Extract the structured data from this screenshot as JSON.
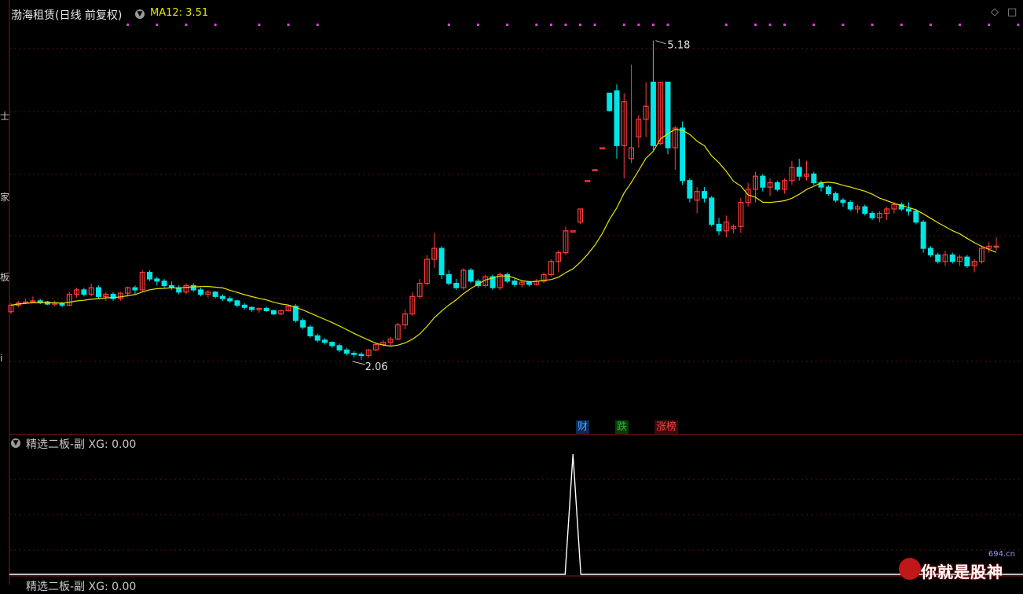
{
  "header": {
    "stock_name": "渤海租赁(日线 前复权)",
    "ma_label": "MA12: 3.51"
  },
  "indicator": {
    "label": "精选二板-副 XG: 0.00",
    "label_bottom": "精选二板-副 XG: 0.00"
  },
  "annotations": {
    "high_label": "5.18",
    "low_label": "2.06"
  },
  "event_tags": [
    {
      "text": "财",
      "color": "#4ea0ff"
    },
    {
      "text": "跌",
      "color": "#20c020"
    },
    {
      "text": "涨榜",
      "color": "#ff4040"
    }
  ],
  "side_labels": [
    "士",
    "家",
    "板",
    "i"
  ],
  "watermark": {
    "text": "你就是股神",
    "site": "694.cn"
  },
  "colors": {
    "up": "#ff3c3c",
    "down": "#00e5e5",
    "ma": "#e6e600",
    "grid": "#5a1010",
    "signal_dots": "#e040e0"
  },
  "chart_data": {
    "type": "candlestick",
    "title": "渤海租赁(日线 前复权)",
    "series_ma": "MA12",
    "price_range": [
      1.8,
      5.3
    ],
    "candles": [
      [
        2.7,
        2.78,
        2.68,
        2.76
      ],
      [
        2.76,
        2.8,
        2.74,
        2.78
      ],
      [
        2.78,
        2.82,
        2.77,
        2.79
      ],
      [
        2.79,
        2.84,
        2.78,
        2.8
      ],
      [
        2.8,
        2.82,
        2.77,
        2.79
      ],
      [
        2.79,
        2.8,
        2.76,
        2.77
      ],
      [
        2.77,
        2.8,
        2.75,
        2.78
      ],
      [
        2.78,
        2.79,
        2.74,
        2.76
      ],
      [
        2.76,
        2.88,
        2.75,
        2.86
      ],
      [
        2.86,
        2.92,
        2.83,
        2.9
      ],
      [
        2.9,
        2.92,
        2.84,
        2.86
      ],
      [
        2.86,
        2.96,
        2.84,
        2.92
      ],
      [
        2.92,
        2.94,
        2.82,
        2.84
      ],
      [
        2.84,
        2.88,
        2.8,
        2.86
      ],
      [
        2.86,
        2.88,
        2.8,
        2.82
      ],
      [
        2.82,
        2.88,
        2.8,
        2.87
      ],
      [
        2.87,
        2.93,
        2.84,
        2.92
      ],
      [
        2.92,
        2.94,
        2.86,
        2.9
      ],
      [
        2.9,
        3.08,
        2.88,
        3.06
      ],
      [
        3.06,
        3.08,
        2.98,
        3.0
      ],
      [
        3.0,
        3.02,
        2.94,
        2.98
      ],
      [
        2.98,
        3.0,
        2.92,
        2.94
      ],
      [
        2.94,
        2.98,
        2.9,
        2.92
      ],
      [
        2.92,
        2.94,
        2.86,
        2.88
      ],
      [
        2.88,
        2.96,
        2.86,
        2.94
      ],
      [
        2.94,
        2.96,
        2.88,
        2.9
      ],
      [
        2.9,
        2.92,
        2.84,
        2.86
      ],
      [
        2.86,
        2.9,
        2.83,
        2.88
      ],
      [
        2.88,
        2.89,
        2.82,
        2.84
      ],
      [
        2.84,
        2.86,
        2.8,
        2.82
      ],
      [
        2.82,
        2.84,
        2.78,
        2.8
      ],
      [
        2.8,
        2.81,
        2.74,
        2.76
      ],
      [
        2.76,
        2.78,
        2.72,
        2.74
      ],
      [
        2.74,
        2.75,
        2.7,
        2.72
      ],
      [
        2.72,
        2.74,
        2.69,
        2.73
      ],
      [
        2.73,
        2.75,
        2.7,
        2.71
      ],
      [
        2.71,
        2.72,
        2.67,
        2.68
      ],
      [
        2.68,
        2.72,
        2.67,
        2.71
      ],
      [
        2.71,
        2.76,
        2.7,
        2.75
      ],
      [
        2.75,
        2.77,
        2.6,
        2.62
      ],
      [
        2.62,
        2.64,
        2.54,
        2.56
      ],
      [
        2.56,
        2.58,
        2.46,
        2.48
      ],
      [
        2.48,
        2.5,
        2.42,
        2.44
      ],
      [
        2.44,
        2.46,
        2.4,
        2.42
      ],
      [
        2.42,
        2.43,
        2.37,
        2.39
      ],
      [
        2.39,
        2.41,
        2.33,
        2.35
      ],
      [
        2.35,
        2.37,
        2.3,
        2.32
      ],
      [
        2.32,
        2.34,
        2.28,
        2.31
      ],
      [
        2.31,
        2.33,
        2.26,
        2.3
      ],
      [
        2.3,
        2.36,
        2.28,
        2.35
      ],
      [
        2.35,
        2.42,
        2.34,
        2.4
      ],
      [
        2.4,
        2.44,
        2.38,
        2.42
      ],
      [
        2.42,
        2.47,
        2.39,
        2.45
      ],
      [
        2.45,
        2.6,
        2.44,
        2.58
      ],
      [
        2.58,
        2.72,
        2.54,
        2.68
      ],
      [
        2.68,
        2.88,
        2.66,
        2.84
      ],
      [
        2.84,
        3.0,
        2.82,
        2.96
      ],
      [
        2.96,
        3.22,
        2.94,
        3.18
      ],
      [
        3.18,
        3.42,
        3.1,
        3.28
      ],
      [
        3.28,
        3.3,
        3.0,
        3.04
      ],
      [
        3.04,
        3.08,
        2.94,
        2.96
      ],
      [
        2.96,
        3.0,
        2.9,
        2.92
      ],
      [
        2.92,
        3.1,
        2.9,
        3.08
      ],
      [
        3.08,
        3.1,
        2.96,
        2.98
      ],
      [
        2.98,
        3.0,
        2.92,
        2.94
      ],
      [
        2.94,
        3.04,
        2.92,
        3.02
      ],
      [
        3.02,
        3.04,
        2.9,
        2.92
      ],
      [
        2.92,
        3.06,
        2.9,
        3.04
      ],
      [
        3.04,
        3.06,
        2.96,
        2.98
      ],
      [
        2.98,
        3.0,
        2.93,
        2.95
      ],
      [
        2.95,
        2.98,
        2.92,
        2.97
      ],
      [
        2.97,
        2.98,
        2.93,
        2.95
      ],
      [
        2.95,
        3.0,
        2.94,
        2.98
      ],
      [
        2.98,
        3.06,
        2.96,
        3.04
      ],
      [
        3.04,
        3.18,
        3.02,
        3.16
      ],
      [
        3.16,
        3.26,
        3.06,
        3.24
      ],
      [
        3.24,
        3.48,
        3.22,
        3.44
      ],
      [
        3.44,
        3.44,
        3.44,
        3.44
      ],
      [
        3.52,
        3.64,
        3.5,
        3.64
      ],
      [
        3.9,
        3.9,
        3.9,
        3.9
      ],
      [
        4.0,
        4.0,
        4.0,
        4.0
      ],
      [
        4.2,
        4.2,
        4.2,
        4.2
      ],
      [
        4.7,
        4.7,
        4.7,
        4.54
      ],
      [
        4.72,
        4.78,
        4.1,
        4.22
      ],
      [
        4.22,
        4.7,
        3.92,
        4.62
      ],
      [
        4.1,
        4.96,
        4.06,
        4.2
      ],
      [
        4.3,
        4.5,
        4.2,
        4.46
      ],
      [
        4.46,
        4.8,
        4.3,
        4.58
      ],
      [
        4.8,
        5.18,
        4.18,
        4.22
      ],
      [
        4.24,
        4.8,
        4.22,
        4.8
      ],
      [
        4.8,
        4.8,
        4.14,
        4.2
      ],
      [
        4.2,
        4.4,
        4.0,
        4.38
      ],
      [
        4.38,
        4.44,
        3.86,
        3.9
      ],
      [
        3.9,
        3.92,
        3.7,
        3.74
      ],
      [
        3.72,
        3.84,
        3.6,
        3.8
      ],
      [
        3.8,
        3.84,
        3.7,
        3.74
      ],
      [
        3.74,
        3.76,
        3.48,
        3.5
      ],
      [
        3.5,
        3.56,
        3.4,
        3.44
      ],
      [
        3.44,
        3.58,
        3.38,
        3.52
      ],
      [
        3.46,
        3.5,
        3.42,
        3.48
      ],
      [
        3.48,
        3.74,
        3.42,
        3.7
      ],
      [
        3.7,
        3.88,
        3.66,
        3.82
      ],
      [
        3.82,
        3.98,
        3.7,
        3.94
      ],
      [
        3.94,
        3.96,
        3.8,
        3.84
      ],
      [
        3.84,
        3.92,
        3.76,
        3.88
      ],
      [
        3.88,
        3.9,
        3.8,
        3.82
      ],
      [
        3.82,
        3.92,
        3.78,
        3.9
      ],
      [
        3.9,
        4.08,
        3.86,
        4.02
      ],
      [
        4.02,
        4.1,
        3.9,
        3.94
      ],
      [
        3.94,
        4.08,
        3.9,
        3.96
      ],
      [
        3.96,
        3.98,
        3.86,
        3.88
      ],
      [
        3.88,
        3.9,
        3.8,
        3.84
      ],
      [
        3.84,
        3.86,
        3.76,
        3.78
      ],
      [
        3.78,
        3.8,
        3.7,
        3.72
      ],
      [
        3.72,
        3.74,
        3.66,
        3.7
      ],
      [
        3.7,
        3.72,
        3.62,
        3.64
      ],
      [
        3.64,
        3.68,
        3.6,
        3.66
      ],
      [
        3.66,
        3.68,
        3.58,
        3.6
      ],
      [
        3.6,
        3.62,
        3.54,
        3.56
      ],
      [
        3.56,
        3.62,
        3.52,
        3.6
      ],
      [
        3.6,
        3.66,
        3.54,
        3.64
      ],
      [
        3.64,
        3.7,
        3.6,
        3.68
      ],
      [
        3.68,
        3.7,
        3.62,
        3.64
      ],
      [
        3.64,
        3.7,
        3.58,
        3.62
      ],
      [
        3.62,
        3.64,
        3.5,
        3.52
      ],
      [
        3.52,
        3.54,
        3.24,
        3.28
      ],
      [
        3.28,
        3.3,
        3.2,
        3.22
      ],
      [
        3.22,
        3.24,
        3.14,
        3.16
      ],
      [
        3.16,
        3.26,
        3.12,
        3.22
      ],
      [
        3.22,
        3.24,
        3.14,
        3.16
      ],
      [
        3.16,
        3.22,
        3.12,
        3.2
      ],
      [
        3.2,
        3.22,
        3.1,
        3.12
      ],
      [
        3.12,
        3.18,
        3.06,
        3.16
      ],
      [
        3.16,
        3.3,
        3.14,
        3.28
      ],
      [
        3.28,
        3.34,
        3.24,
        3.3
      ],
      [
        3.3,
        3.38,
        3.26,
        3.3
      ]
    ],
    "signal_index": 77
  }
}
